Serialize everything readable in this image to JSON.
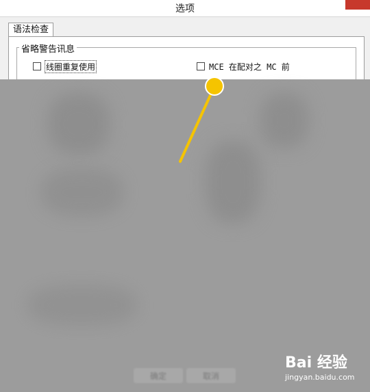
{
  "window": {
    "title": "选项"
  },
  "tabs": [
    {
      "label": "语法检查"
    }
  ],
  "group": {
    "title": "省略警告讯息",
    "options": [
      {
        "label": "线圈重复使用",
        "checked": false
      },
      {
        "label": "MCE 在配对之 MC 前",
        "checked": false
      }
    ]
  },
  "buttons": {
    "ok": "确定",
    "cancel": "取消"
  },
  "watermark": {
    "brand": "Bai 经验",
    "url": "jingyan.baidu.com"
  },
  "colors": {
    "pointer": "#f5c400",
    "overlay": "#9c9c9c",
    "close": "#c7382c"
  }
}
